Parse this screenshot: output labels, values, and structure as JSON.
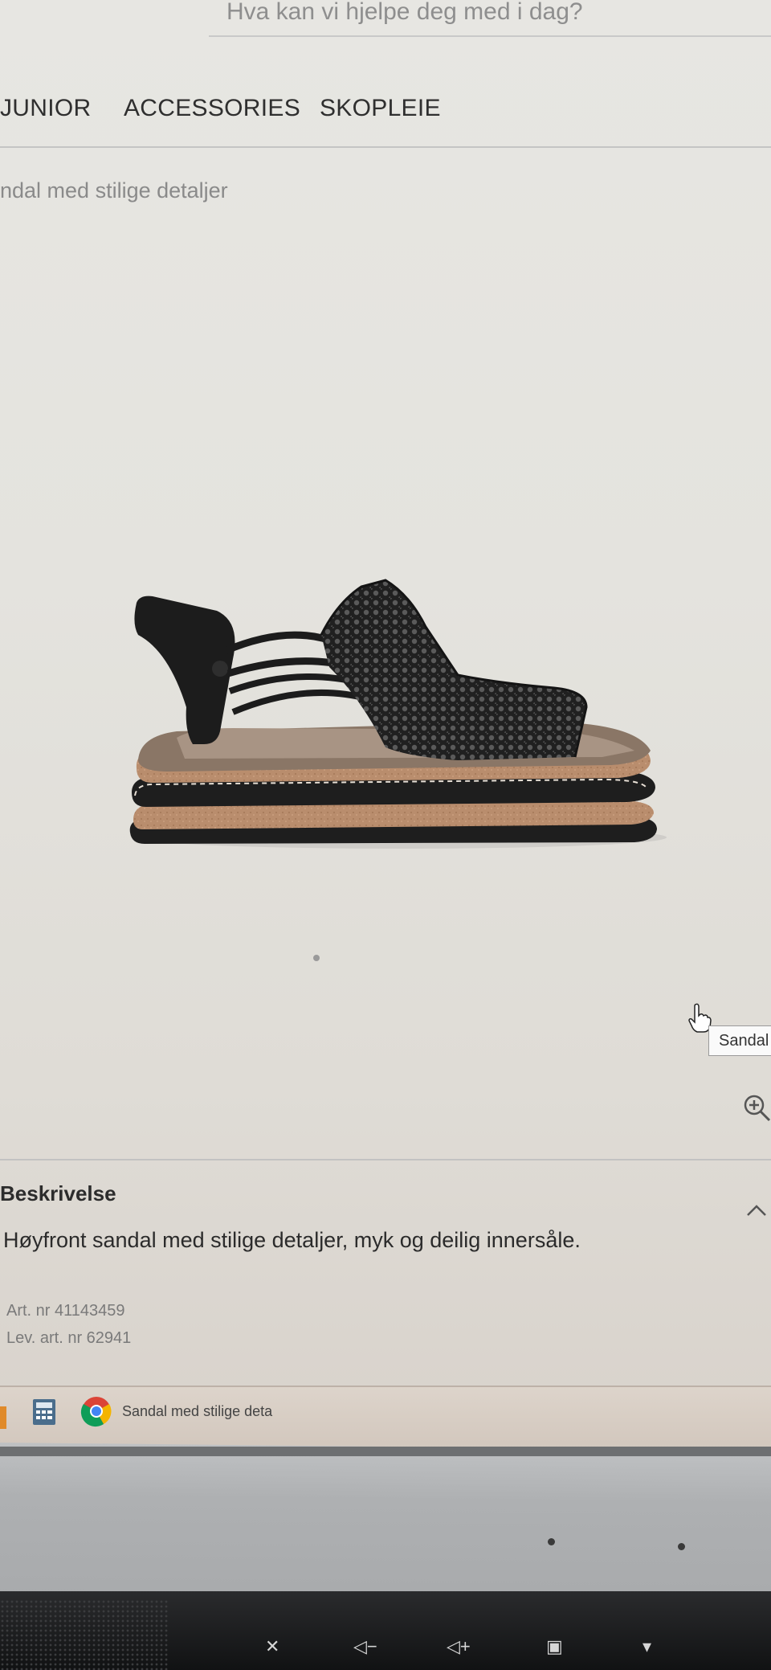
{
  "header": {
    "search_text": "Hva kan vi hjelpe deg med i dag?"
  },
  "nav": {
    "items": [
      {
        "label": "JUNIOR"
      },
      {
        "label": "ACCESSORIES"
      },
      {
        "label": "SKOPLEIE"
      }
    ]
  },
  "breadcrumb": "ndal med stilige detaljer",
  "product": {
    "tooltip": "Sandal"
  },
  "description": {
    "heading": "Beskrivelse",
    "text": "Høyfront sandal med stilige detaljer, myk og deilig innersåle.",
    "art_nr": "Art. nr 41143459",
    "lev_art_nr": "Lev. art. nr 62941"
  },
  "taskbar": {
    "window_title": "Sandal med stilige deta"
  },
  "colors": {
    "accent_orange": "#e08a2a",
    "sandal_black": "#1c1c1c",
    "cork": "#b98d6d"
  }
}
